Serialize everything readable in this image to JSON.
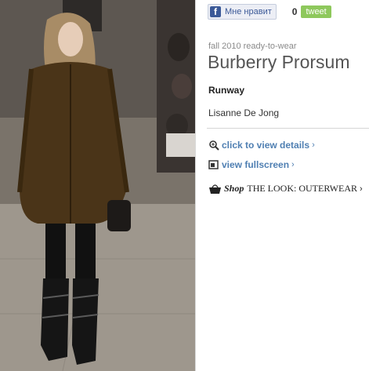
{
  "photo": {
    "description_icon": "runway-photo",
    "colors": {
      "coat": "#4a3418",
      "floor": "#9e978d"
    }
  },
  "social": {
    "like_label": "Мне нравит",
    "like_count": "0",
    "tweet_label": "tweet",
    "colors": {
      "facebook": "#3b5998",
      "tweet": "#8ec85c"
    }
  },
  "header": {
    "season": "fall 2010 ready-to-wear",
    "designer": "Burberry Prorsum"
  },
  "details": {
    "category": "Runway",
    "model": "Lisanne De Jong"
  },
  "links": {
    "view_details": {
      "label": "click to view details",
      "arrow": "›",
      "icon": "magnifier-icon"
    },
    "view_fullscreen": {
      "label": "view fullscreen",
      "arrow": "›",
      "icon": "fullscreen-icon"
    },
    "shop": {
      "prefix": "Shop",
      "label": "THE LOOK: OUTERWEAR",
      "arrow": "›",
      "icon": "shopping-bag-icon"
    }
  },
  "colors": {
    "link": "#4f7fb2",
    "title": "#555555"
  }
}
